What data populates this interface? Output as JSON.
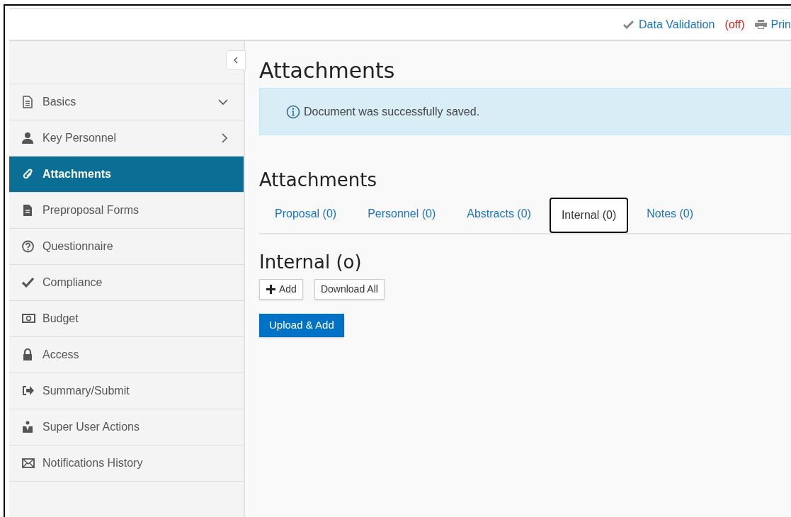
{
  "toolbar": {
    "validation_label": "Data Validation",
    "validation_state": "(off)",
    "print_label": "Prin"
  },
  "sidebar": {
    "items": [
      {
        "label": "Basics",
        "selected": false,
        "expanded": true
      },
      {
        "label": "Key Personnel",
        "selected": false,
        "expanded": false
      },
      {
        "label": "Attachments",
        "selected": true
      },
      {
        "label": "Preproposal Forms",
        "selected": false
      },
      {
        "label": "Questionnaire",
        "selected": false
      },
      {
        "label": "Compliance",
        "selected": false
      },
      {
        "label": "Budget",
        "selected": false
      },
      {
        "label": "Access",
        "selected": false
      },
      {
        "label": "Summary/Submit",
        "selected": false
      },
      {
        "label": "Super User Actions",
        "selected": false
      },
      {
        "label": "Notifications History",
        "selected": false
      }
    ]
  },
  "page_title": "Attachments",
  "alert": "Document was successfully saved.",
  "section_title": "Attachments",
  "tabs": [
    {
      "label": "Proposal (0)",
      "selected": false
    },
    {
      "label": "Personnel (0)",
      "selected": false
    },
    {
      "label": "Abstracts (0)",
      "selected": false
    },
    {
      "label": "Internal (0)",
      "selected": true
    },
    {
      "label": "Notes (0)",
      "selected": false
    }
  ],
  "panel_title": "Internal (o)",
  "buttons": {
    "add": "Add",
    "download": "Download All",
    "upload": "Upload & Add"
  }
}
